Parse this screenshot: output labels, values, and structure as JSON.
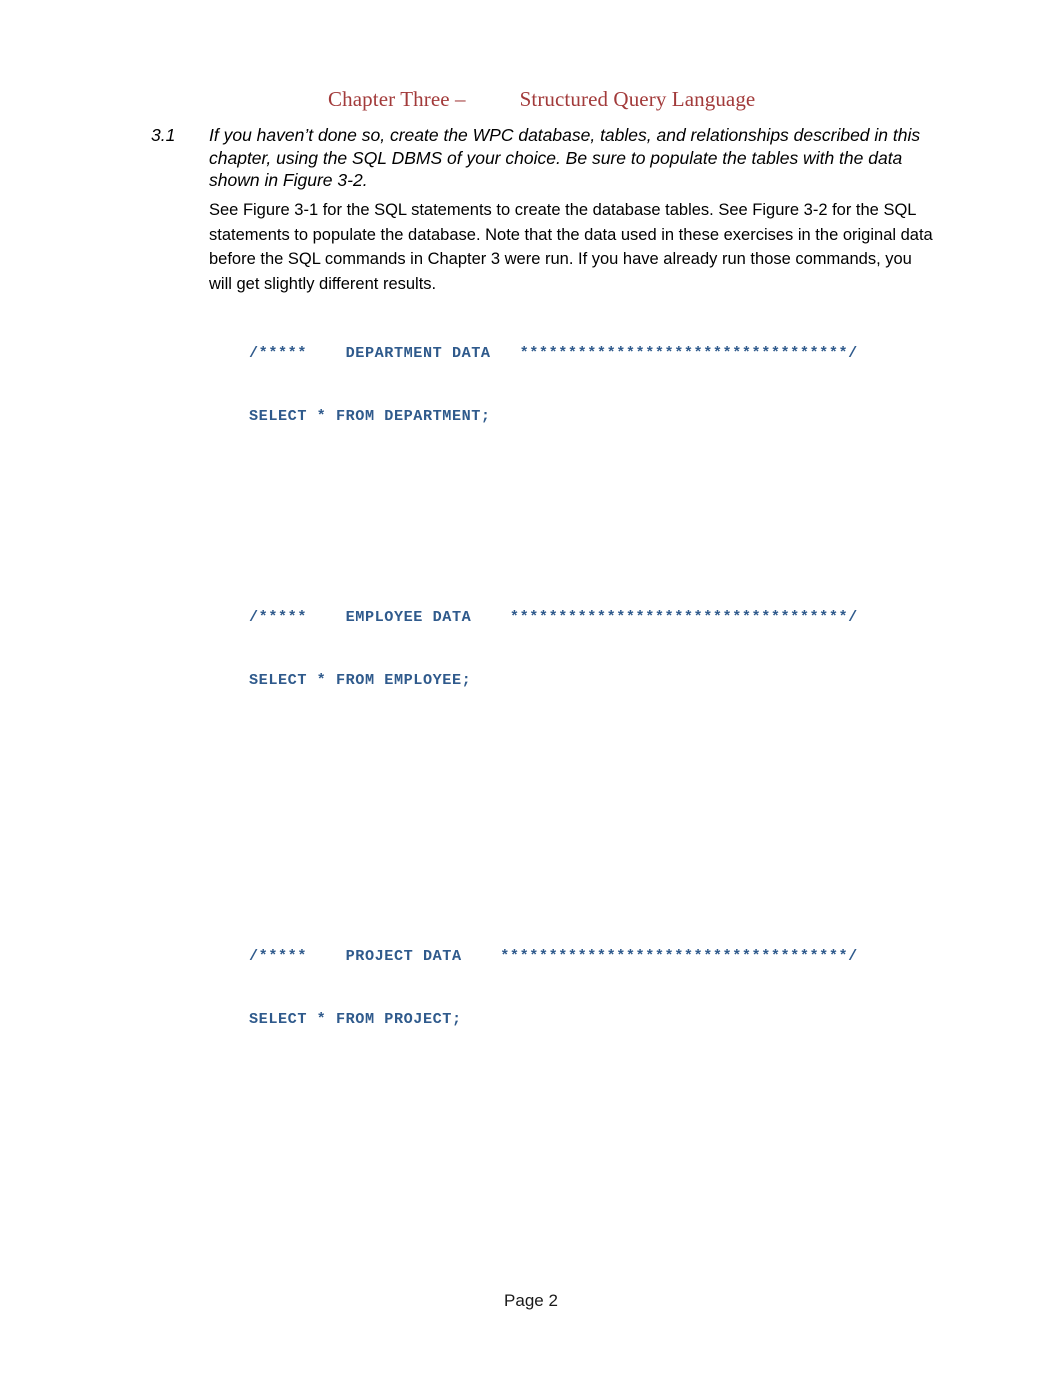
{
  "header": {
    "chapter": "Chapter Three –",
    "title": "Structured Query Language"
  },
  "exercise": {
    "number": "3.1",
    "prompt": "If you haven’t done so, create the WPC database, tables, and relationships described in this chapter, using the SQL DBMS of your choice. Be sure to populate the tables with the data shown in Figure 3-2.",
    "answer": "See Figure 3-1 for the SQL statements to create the database tables.  See Figure 3-2 for the SQL statements to populate the database.  Note that the data used in these exercises in the original data before the SQL commands in Chapter 3 were run.  If you have already run those commands, you will get slightly different results."
  },
  "code_blocks": [
    {
      "id": "department",
      "comment": "/*****    DEPARTMENT DATA   **********************************/",
      "statement": "SELECT * FROM DEPARTMENT;"
    },
    {
      "id": "employee",
      "comment": "/*****    EMPLOYEE DATA    ***********************************/",
      "statement": "SELECT * FROM EMPLOYEE;"
    },
    {
      "id": "project",
      "comment": "/*****    PROJECT DATA    ************************************/",
      "statement": "SELECT * FROM PROJECT;"
    }
  ],
  "footer": {
    "page_label": "Page 2"
  },
  "colors": {
    "header_red": "#A23A3A",
    "code_blue": "#2F5A8C",
    "body_text": "#000000",
    "page_background": "#FFFFFF"
  }
}
